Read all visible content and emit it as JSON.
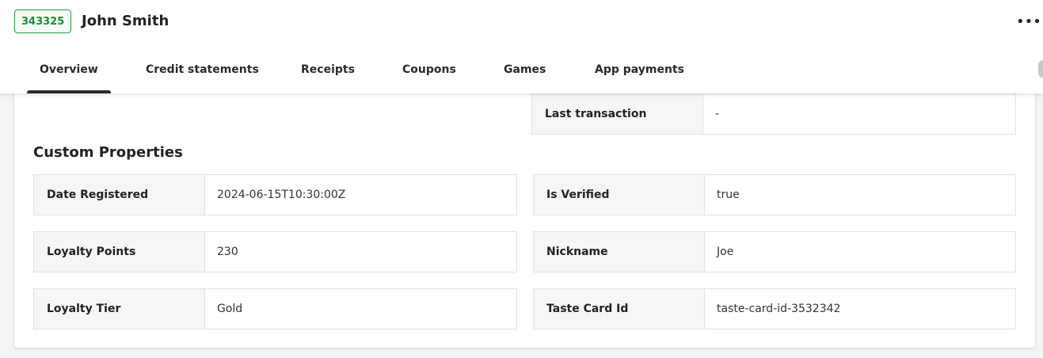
{
  "header": {
    "customer_id": "343325",
    "customer_name": "John Smith",
    "more_icon": "more-horizontal-icon"
  },
  "tabs": [
    {
      "label": "Overview",
      "active": true
    },
    {
      "label": "Credit statements",
      "active": false
    },
    {
      "label": "Receipts",
      "active": false
    },
    {
      "label": "Coupons",
      "active": false
    },
    {
      "label": "Games",
      "active": false
    },
    {
      "label": "App payments",
      "active": false
    }
  ],
  "summary": {
    "last_transaction_label": "Last transaction",
    "last_transaction_value": "-"
  },
  "custom_properties": {
    "title": "Custom Properties",
    "left": [
      {
        "label": "Date Registered",
        "value": "2024-06-15T10:30:00Z"
      },
      {
        "label": "Loyalty Points",
        "value": "230"
      },
      {
        "label": "Loyalty Tier",
        "value": "Gold"
      }
    ],
    "right": [
      {
        "label": "Is Verified",
        "value": "true"
      },
      {
        "label": "Nickname",
        "value": "Joe"
      },
      {
        "label": "Taste Card Id",
        "value": "taste-card-id-3532342"
      }
    ]
  },
  "colors": {
    "badge_green": "#1f8a3a",
    "page_background": "#f4f4f5",
    "label_background": "#f6f6f6"
  }
}
